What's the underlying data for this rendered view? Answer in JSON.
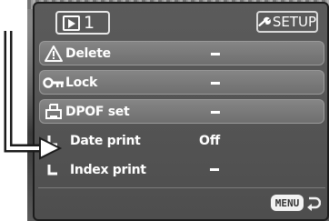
{
  "header": {
    "playback_tab_number": "1",
    "setup_label": "SETUP"
  },
  "menu": {
    "items": [
      {
        "label": "Delete",
        "value": "",
        "icon": "warning-triangle-icon"
      },
      {
        "label": "Lock",
        "value": "",
        "icon": "key-icon"
      },
      {
        "label": "DPOF set",
        "value": "",
        "icon": "print-icon"
      },
      {
        "label": "Date print",
        "value": "Off",
        "icon": "sub-item-bracket-icon"
      },
      {
        "label": "Index print",
        "value": "",
        "icon": "sub-item-bracket-icon"
      }
    ]
  },
  "footer": {
    "menu_key": "MENU"
  },
  "colors": {
    "panel": "#555555",
    "row": "#7a7a7a",
    "text": "#ffffff"
  }
}
